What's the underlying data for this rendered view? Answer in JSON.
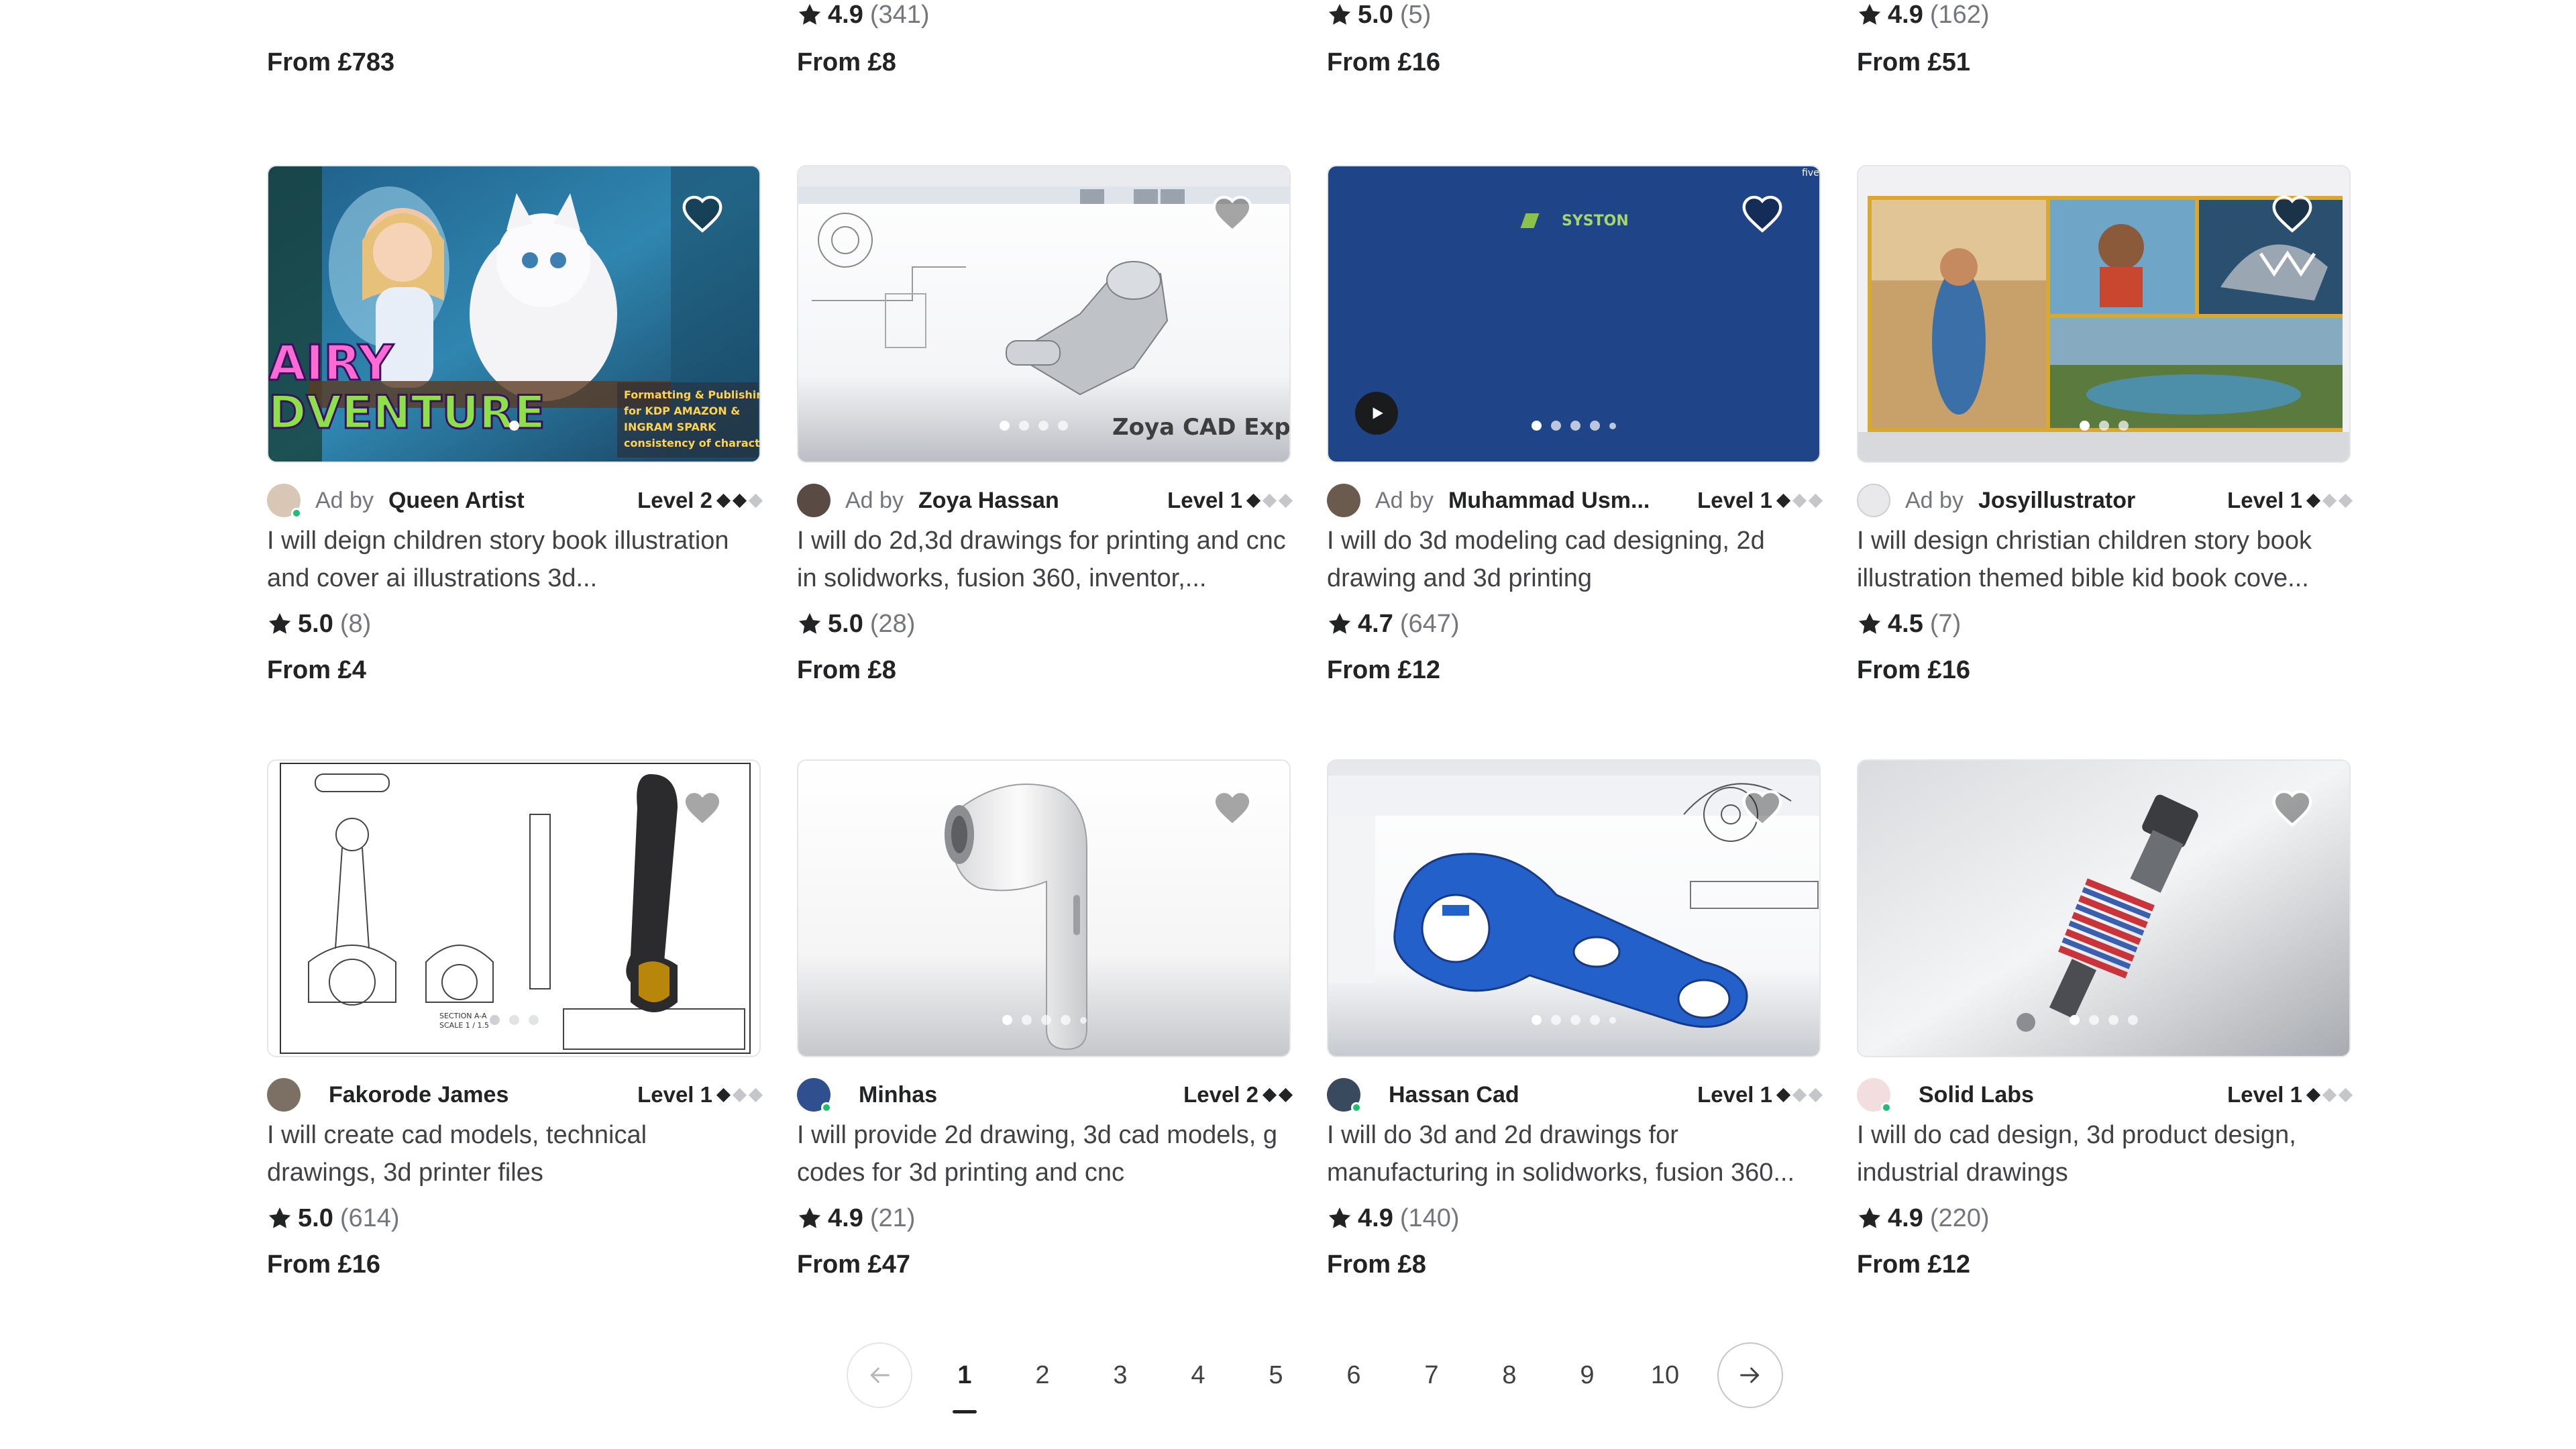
{
  "top_row": [
    {
      "rating": "",
      "count": "",
      "price": "From £783"
    },
    {
      "rating": "4.9",
      "count": "(341)",
      "price": "From £8"
    },
    {
      "rating": "5.0",
      "count": "(5)",
      "price": "From £16"
    },
    {
      "rating": "4.9",
      "count": "(162)",
      "price": "From £51"
    }
  ],
  "gigs": [
    {
      "ad_label": "Ad by",
      "seller": "Queen Artist",
      "level": "Level 2",
      "level_filled": 2,
      "title": "I will deign children story book illustration and cover ai illustrations 3d...",
      "rating": "5.0",
      "count": "(8)",
      "price": "From £4",
      "thumb_text": [
        "AIRY",
        "DVENTURE",
        "Formatting & Publishing",
        "for KDP AMAZON &",
        "INGRAM SPARK",
        "consistency of character"
      ]
    },
    {
      "ad_label": "Ad by",
      "seller": "Zoya Hassan",
      "level": "Level 1",
      "level_filled": 1,
      "title": "I will do 2d,3d drawings for printing and cnc in solidworks, fusion 360, inventor,...",
      "rating": "5.0",
      "count": "(28)",
      "price": "From £8",
      "thumb_text": [
        "Zoya CAD Expe"
      ]
    },
    {
      "ad_label": "Ad by",
      "seller": "Muhammad Usm...",
      "level": "Level 1",
      "level_filled": 1,
      "title": "I will do 3d modeling cad designing, 2d drawing and 3d printing",
      "rating": "4.7",
      "count": "(647)",
      "price": "From £12",
      "thumb_text": [
        "SYSTON",
        "fiverr"
      ]
    },
    {
      "ad_label": "Ad by",
      "seller": "Josyillustrator",
      "level": "Level 1",
      "level_filled": 1,
      "title": "I will design christian children story book illustration themed bible kid book cove...",
      "rating": "4.5",
      "count": "(7)",
      "price": "From £16",
      "thumb_text": []
    },
    {
      "ad_label": "",
      "seller": "Fakorode James",
      "level": "Level 1",
      "level_filled": 1,
      "title": "I will create cad models, technical drawings, 3d printer files",
      "rating": "5.0",
      "count": "(614)",
      "price": "From £16",
      "thumb_text": [
        "SECTION A-A",
        "SCALE 1 / 1.5"
      ]
    },
    {
      "ad_label": "",
      "seller": "Minhas",
      "level": "Level 2",
      "level_filled": 2,
      "title": "I will provide 2d drawing, 3d cad models, g codes for 3d printing and cnc",
      "rating": "4.9",
      "count": "(21)",
      "price": "From £47",
      "thumb_text": []
    },
    {
      "ad_label": "",
      "seller": "Hassan Cad",
      "level": "Level 1",
      "level_filled": 1,
      "title": "I will do 3d and 2d drawings for manufacturing in solidworks, fusion 360...",
      "rating": "4.9",
      "count": "(140)",
      "price": "From £8",
      "thumb_text": []
    },
    {
      "ad_label": "",
      "seller": "Solid Labs",
      "level": "Level 1",
      "level_filled": 1,
      "title": "I will do cad design, 3d product design, industrial drawings",
      "rating": "4.9",
      "count": "(220)",
      "price": "From £12",
      "thumb_text": []
    }
  ],
  "pagination": {
    "prev_icon": "arrow-left-icon",
    "next_icon": "arrow-right-icon",
    "pages": [
      "1",
      "2",
      "3",
      "4",
      "5",
      "6",
      "7",
      "8",
      "9",
      "10"
    ],
    "current": "1"
  },
  "colors": {
    "text_dark": "#222325",
    "text_body": "#404145",
    "text_muted": "#74767e",
    "online": "#1dbf73",
    "border": "#e4e5e7"
  }
}
